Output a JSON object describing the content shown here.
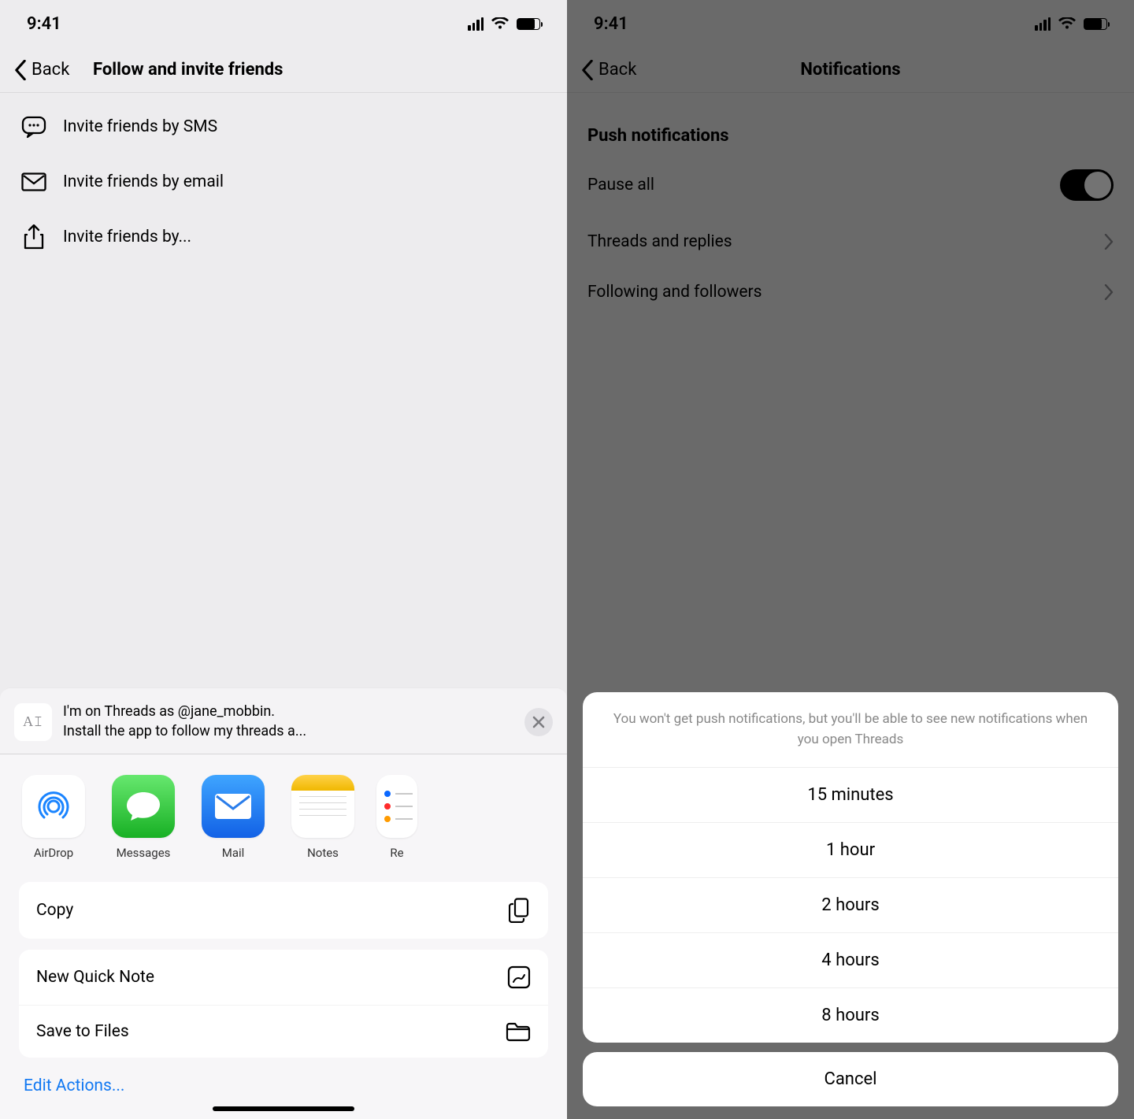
{
  "status": {
    "time": "9:41"
  },
  "left": {
    "back": "Back",
    "title": "Follow and invite friends",
    "invite": {
      "sms": "Invite friends by SMS",
      "email": "Invite friends by email",
      "share": "Invite friends by..."
    },
    "share_sheet": {
      "doc_glyph": "A𝙸",
      "line1": "I'm on Threads as @jane_mobbin.",
      "line2": "Install the app to follow my threads a...",
      "apps": [
        {
          "label": "AirDrop"
        },
        {
          "label": "Messages"
        },
        {
          "label": "Mail"
        },
        {
          "label": "Notes"
        },
        {
          "label": "Re"
        }
      ],
      "actions": {
        "copy": "Copy",
        "quick_note": "New Quick Note",
        "save_files": "Save to Files"
      },
      "edit_actions": "Edit Actions..."
    }
  },
  "right": {
    "back": "Back",
    "title": "Notifications",
    "section": "Push notifications",
    "rows": {
      "pause_all": "Pause all",
      "threads_replies": "Threads and replies",
      "following_followers": "Following and followers"
    },
    "sheet": {
      "message": "You won't get push notifications, but you'll be able to see new notifications when you open Threads",
      "options": [
        "15 minutes",
        "1 hour",
        "2 hours",
        "4 hours",
        "8 hours"
      ],
      "cancel": "Cancel"
    }
  }
}
